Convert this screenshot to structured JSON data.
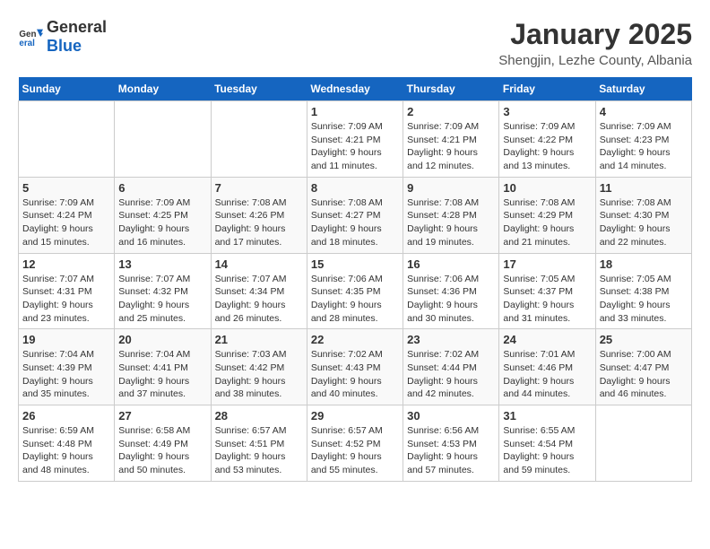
{
  "header": {
    "logo_general": "General",
    "logo_blue": "Blue",
    "title": "January 2025",
    "subtitle": "Shengjin, Lezhe County, Albania"
  },
  "days_of_week": [
    "Sunday",
    "Monday",
    "Tuesday",
    "Wednesday",
    "Thursday",
    "Friday",
    "Saturday"
  ],
  "weeks": [
    [
      {
        "day": "",
        "info": ""
      },
      {
        "day": "",
        "info": ""
      },
      {
        "day": "",
        "info": ""
      },
      {
        "day": "1",
        "info": "Sunrise: 7:09 AM\nSunset: 4:21 PM\nDaylight: 9 hours\nand 11 minutes."
      },
      {
        "day": "2",
        "info": "Sunrise: 7:09 AM\nSunset: 4:21 PM\nDaylight: 9 hours\nand 12 minutes."
      },
      {
        "day": "3",
        "info": "Sunrise: 7:09 AM\nSunset: 4:22 PM\nDaylight: 9 hours\nand 13 minutes."
      },
      {
        "day": "4",
        "info": "Sunrise: 7:09 AM\nSunset: 4:23 PM\nDaylight: 9 hours\nand 14 minutes."
      }
    ],
    [
      {
        "day": "5",
        "info": "Sunrise: 7:09 AM\nSunset: 4:24 PM\nDaylight: 9 hours\nand 15 minutes."
      },
      {
        "day": "6",
        "info": "Sunrise: 7:09 AM\nSunset: 4:25 PM\nDaylight: 9 hours\nand 16 minutes."
      },
      {
        "day": "7",
        "info": "Sunrise: 7:08 AM\nSunset: 4:26 PM\nDaylight: 9 hours\nand 17 minutes."
      },
      {
        "day": "8",
        "info": "Sunrise: 7:08 AM\nSunset: 4:27 PM\nDaylight: 9 hours\nand 18 minutes."
      },
      {
        "day": "9",
        "info": "Sunrise: 7:08 AM\nSunset: 4:28 PM\nDaylight: 9 hours\nand 19 minutes."
      },
      {
        "day": "10",
        "info": "Sunrise: 7:08 AM\nSunset: 4:29 PM\nDaylight: 9 hours\nand 21 minutes."
      },
      {
        "day": "11",
        "info": "Sunrise: 7:08 AM\nSunset: 4:30 PM\nDaylight: 9 hours\nand 22 minutes."
      }
    ],
    [
      {
        "day": "12",
        "info": "Sunrise: 7:07 AM\nSunset: 4:31 PM\nDaylight: 9 hours\nand 23 minutes."
      },
      {
        "day": "13",
        "info": "Sunrise: 7:07 AM\nSunset: 4:32 PM\nDaylight: 9 hours\nand 25 minutes."
      },
      {
        "day": "14",
        "info": "Sunrise: 7:07 AM\nSunset: 4:34 PM\nDaylight: 9 hours\nand 26 minutes."
      },
      {
        "day": "15",
        "info": "Sunrise: 7:06 AM\nSunset: 4:35 PM\nDaylight: 9 hours\nand 28 minutes."
      },
      {
        "day": "16",
        "info": "Sunrise: 7:06 AM\nSunset: 4:36 PM\nDaylight: 9 hours\nand 30 minutes."
      },
      {
        "day": "17",
        "info": "Sunrise: 7:05 AM\nSunset: 4:37 PM\nDaylight: 9 hours\nand 31 minutes."
      },
      {
        "day": "18",
        "info": "Sunrise: 7:05 AM\nSunset: 4:38 PM\nDaylight: 9 hours\nand 33 minutes."
      }
    ],
    [
      {
        "day": "19",
        "info": "Sunrise: 7:04 AM\nSunset: 4:39 PM\nDaylight: 9 hours\nand 35 minutes."
      },
      {
        "day": "20",
        "info": "Sunrise: 7:04 AM\nSunset: 4:41 PM\nDaylight: 9 hours\nand 37 minutes."
      },
      {
        "day": "21",
        "info": "Sunrise: 7:03 AM\nSunset: 4:42 PM\nDaylight: 9 hours\nand 38 minutes."
      },
      {
        "day": "22",
        "info": "Sunrise: 7:02 AM\nSunset: 4:43 PM\nDaylight: 9 hours\nand 40 minutes."
      },
      {
        "day": "23",
        "info": "Sunrise: 7:02 AM\nSunset: 4:44 PM\nDaylight: 9 hours\nand 42 minutes."
      },
      {
        "day": "24",
        "info": "Sunrise: 7:01 AM\nSunset: 4:46 PM\nDaylight: 9 hours\nand 44 minutes."
      },
      {
        "day": "25",
        "info": "Sunrise: 7:00 AM\nSunset: 4:47 PM\nDaylight: 9 hours\nand 46 minutes."
      }
    ],
    [
      {
        "day": "26",
        "info": "Sunrise: 6:59 AM\nSunset: 4:48 PM\nDaylight: 9 hours\nand 48 minutes."
      },
      {
        "day": "27",
        "info": "Sunrise: 6:58 AM\nSunset: 4:49 PM\nDaylight: 9 hours\nand 50 minutes."
      },
      {
        "day": "28",
        "info": "Sunrise: 6:57 AM\nSunset: 4:51 PM\nDaylight: 9 hours\nand 53 minutes."
      },
      {
        "day": "29",
        "info": "Sunrise: 6:57 AM\nSunset: 4:52 PM\nDaylight: 9 hours\nand 55 minutes."
      },
      {
        "day": "30",
        "info": "Sunrise: 6:56 AM\nSunset: 4:53 PM\nDaylight: 9 hours\nand 57 minutes."
      },
      {
        "day": "31",
        "info": "Sunrise: 6:55 AM\nSunset: 4:54 PM\nDaylight: 9 hours\nand 59 minutes."
      },
      {
        "day": "",
        "info": ""
      }
    ]
  ]
}
